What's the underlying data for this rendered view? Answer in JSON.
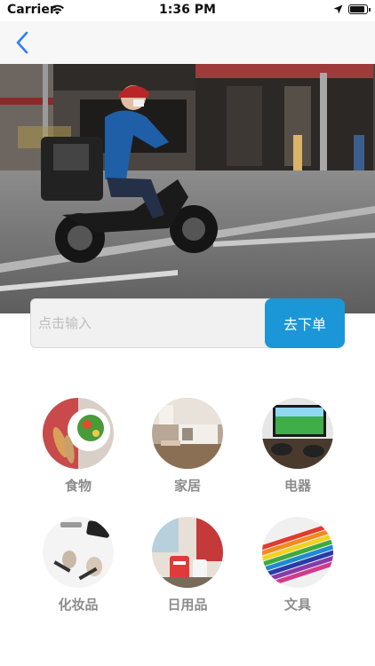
{
  "status": {
    "carrier": "Carrier",
    "time": "1:36 PM"
  },
  "nav": {
    "back_icon": "chevron-left-icon",
    "accent": "#2a7fff"
  },
  "hero": {
    "image": "photo of a delivery courier riding an electric scooter on a city street"
  },
  "search": {
    "placeholder": "点击输入",
    "value": "",
    "button_label": "去下单",
    "button_color": "#1b97d8"
  },
  "categories": [
    {
      "label": "食物",
      "icon": "food-photo"
    },
    {
      "label": "家居",
      "icon": "home-photo"
    },
    {
      "label": "电器",
      "icon": "electronics-photo"
    },
    {
      "label": "化妆品",
      "icon": "cosmetics-photo"
    },
    {
      "label": "日用品",
      "icon": "daily-goods-photo"
    },
    {
      "label": "文具",
      "icon": "stationery-photo"
    }
  ]
}
